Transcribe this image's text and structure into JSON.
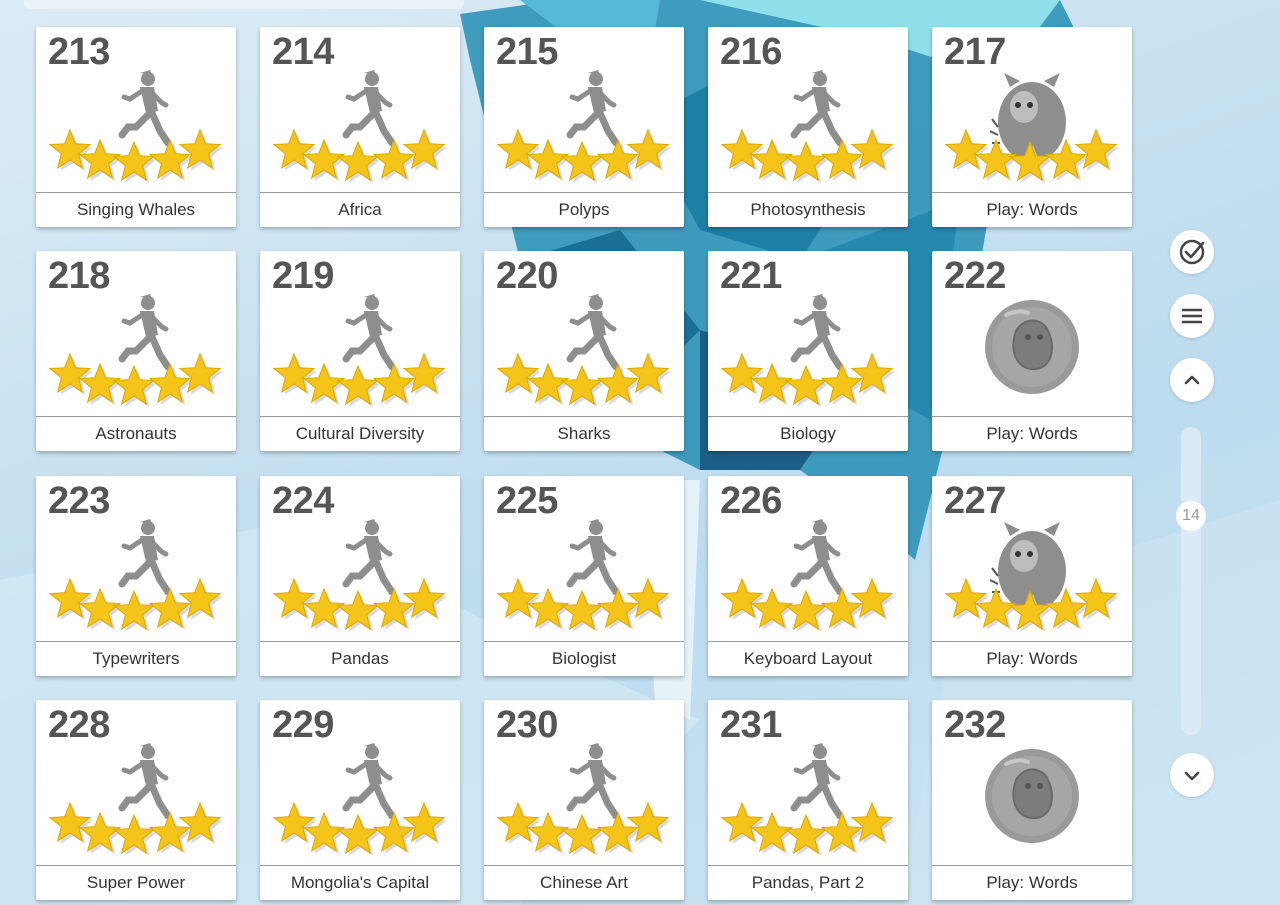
{
  "levels": [
    {
      "number": "213",
      "title": "Singing Whales",
      "icon": "runner-icon",
      "stars": 5
    },
    {
      "number": "214",
      "title": "Africa",
      "icon": "runner-icon",
      "stars": 5
    },
    {
      "number": "215",
      "title": "Polyps",
      "icon": "runner-icon",
      "stars": 5
    },
    {
      "number": "216",
      "title": "Photosynthesis",
      "icon": "runner-icon",
      "stars": 5
    },
    {
      "number": "217",
      "title": "Play: Words",
      "icon": "monster-icon",
      "stars": 5
    },
    {
      "number": "218",
      "title": "Astronauts",
      "icon": "runner-icon",
      "stars": 5
    },
    {
      "number": "219",
      "title": "Cultural Diversity",
      "icon": "runner-icon",
      "stars": 5
    },
    {
      "number": "220",
      "title": "Sharks",
      "icon": "runner-icon",
      "stars": 5
    },
    {
      "number": "221",
      "title": "Biology",
      "icon": "runner-icon",
      "stars": 5
    },
    {
      "number": "222",
      "title": "Play: Words",
      "icon": "locked-creature-icon",
      "stars": 0
    },
    {
      "number": "223",
      "title": "Typewriters",
      "icon": "runner-icon",
      "stars": 5
    },
    {
      "number": "224",
      "title": "Pandas",
      "icon": "runner-icon",
      "stars": 5
    },
    {
      "number": "225",
      "title": "Biologist",
      "icon": "runner-icon",
      "stars": 5
    },
    {
      "number": "226",
      "title": "Keyboard Layout",
      "icon": "runner-icon",
      "stars": 5
    },
    {
      "number": "227",
      "title": "Play: Words",
      "icon": "monster-icon",
      "stars": 5
    },
    {
      "number": "228",
      "title": "Super Power",
      "icon": "runner-icon",
      "stars": 5
    },
    {
      "number": "229",
      "title": "Mongolia's Capital",
      "icon": "runner-icon",
      "stars": 5
    },
    {
      "number": "230",
      "title": "Chinese Art",
      "icon": "runner-icon",
      "stars": 5
    },
    {
      "number": "231",
      "title": "Pandas, Part 2",
      "icon": "runner-icon",
      "stars": 5
    },
    {
      "number": "232",
      "title": "Play: Words",
      "icon": "locked-creature-icon",
      "stars": 0
    }
  ],
  "sidebar": {
    "buttons": [
      {
        "name": "check-circle-button",
        "icon": "check-circle-icon"
      },
      {
        "name": "menu-button",
        "icon": "hamburger-menu-icon"
      },
      {
        "name": "scroll-up-button",
        "icon": "chevron-up-icon"
      },
      {
        "name": "scroll-down-button",
        "icon": "chevron-down-icon"
      }
    ],
    "scroll_position": "14"
  },
  "colors": {
    "star": "#f4c418",
    "icon_gray": "#8e8e8e",
    "number": "#555555"
  }
}
